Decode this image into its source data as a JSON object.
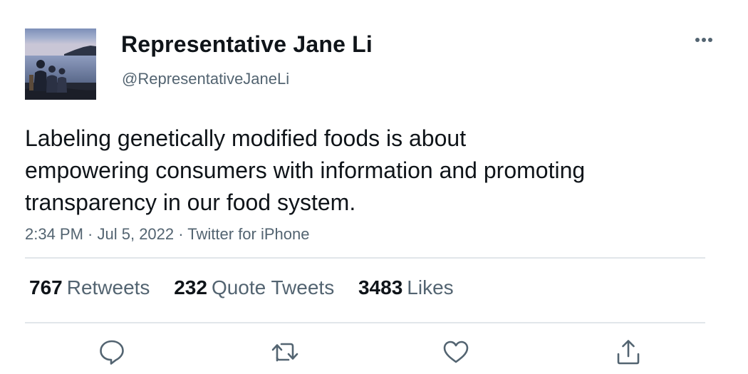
{
  "author": {
    "display_name": "Representative Jane Li",
    "handle": "@RepresentativeJaneLi",
    "avatar_icon": "profile-photo-lake-silhouettes"
  },
  "menu": {
    "more_icon": "more-horizontal-icon"
  },
  "tweet": {
    "text_lines": [
      "Labeling genetically modified foods is about",
      "empowering consumers with information and promoting",
      "transparency in our food system."
    ],
    "time": "2:34 PM",
    "date": "Jul 5, 2022",
    "source": "Twitter for iPhone",
    "separator": " · "
  },
  "stats": [
    {
      "count": "767",
      "label": "Retweets"
    },
    {
      "count": "232",
      "label": "Quote Tweets"
    },
    {
      "count": "3483",
      "label": "Likes"
    }
  ],
  "actions": [
    {
      "name": "reply",
      "icon": "reply-icon"
    },
    {
      "name": "retweet",
      "icon": "retweet-icon"
    },
    {
      "name": "like",
      "icon": "heart-icon"
    },
    {
      "name": "share",
      "icon": "share-icon"
    }
  ],
  "colors": {
    "text_primary": "#0f1419",
    "text_secondary": "#536471",
    "divider": "#e1e6ea"
  }
}
